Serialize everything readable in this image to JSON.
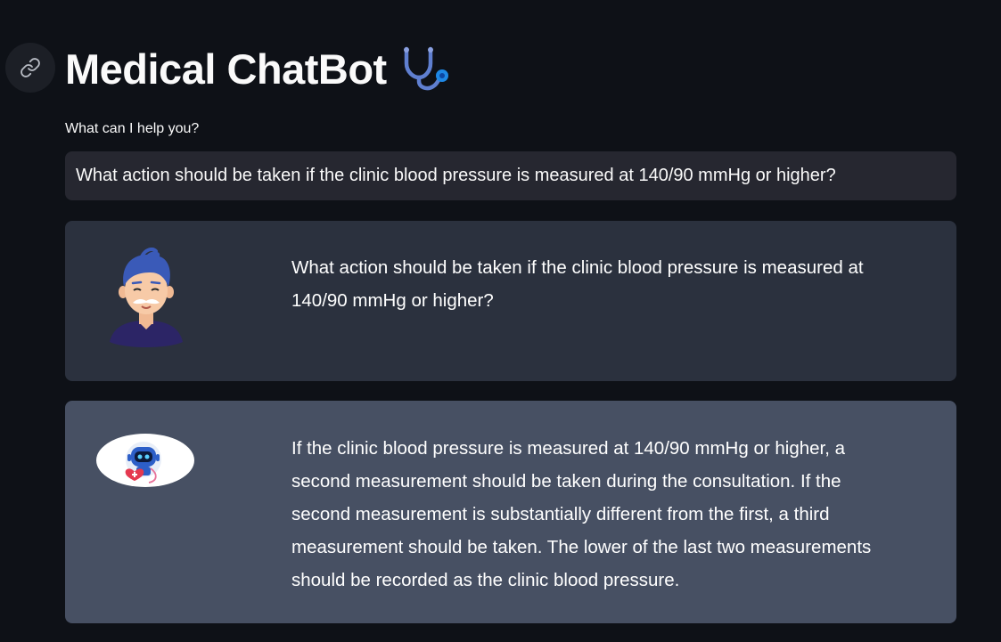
{
  "header": {
    "title": "Medical ChatBot",
    "title_icon": "stethoscope-icon",
    "anchor_icon": "link-icon"
  },
  "query": {
    "label": "What can I help you?",
    "value": "What action should be taken if the clinic blood pressure is measured at 140/90 mmHg or higher?"
  },
  "messages": [
    {
      "role": "user",
      "avatar": "user-avatar",
      "text": "What action should be taken if the clinic blood pressure is measured at 140/90 mmHg or higher?"
    },
    {
      "role": "bot",
      "avatar": "bot-avatar",
      "text": "If the clinic blood pressure is measured at 140/90 mmHg or higher, a second measurement should be taken during the consultation. If the second measurement is substantially different from the first, a third measurement should be taken. The lower of the last two measurements should be recorded as the clinic blood pressure."
    }
  ],
  "colors": {
    "background": "#0e1117",
    "input_bg": "#262730",
    "user_msg_bg": "#2b313e",
    "bot_msg_bg": "#475063",
    "accent_blue": "#1e88e5"
  }
}
